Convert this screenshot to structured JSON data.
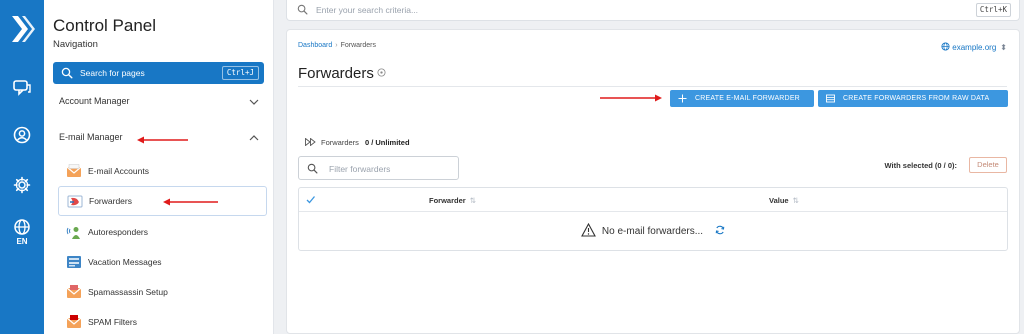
{
  "rail": {
    "language": "EN",
    "icons": [
      "logo-icon",
      "chat-icon",
      "account-icon",
      "settings-icon",
      "globe-icon"
    ]
  },
  "sidebar": {
    "title": "Control Panel",
    "subtitle": "Navigation",
    "search_label": "Search for pages",
    "search_shortcut": "Ctrl+J",
    "sections": [
      {
        "label": "Account Manager",
        "expanded": false
      },
      {
        "label": "E-mail Manager",
        "expanded": true
      }
    ],
    "items": [
      {
        "label": "E-mail Accounts",
        "icon": "email-accounts-icon"
      },
      {
        "label": "Forwarders",
        "icon": "forwarders-icon",
        "active": true
      },
      {
        "label": "Autoresponders",
        "icon": "autoresponders-icon"
      },
      {
        "label": "Vacation Messages",
        "icon": "vacation-messages-icon"
      },
      {
        "label": "Spamassassin Setup",
        "icon": "spamassassin-icon"
      },
      {
        "label": "SPAM Filters",
        "icon": "spam-filters-icon"
      }
    ]
  },
  "topbar": {
    "search_placeholder": "Enter your search criteria...",
    "shortcut": "Ctrl+K"
  },
  "main": {
    "breadcrumb": [
      "Dashboard",
      "Forwarders"
    ],
    "domain": "example.org",
    "title": "Forwarders",
    "buttons": {
      "create": "CREATE E-MAIL FORWARDER",
      "raw": "CREATE FORWARDERS FROM RAW DATA"
    },
    "count_label": "Forwarders",
    "count_value": "0 / Unlimited",
    "filter_placeholder": "Filter forwarders",
    "with_selected": "With selected (0 / 0):",
    "delete_label": "Delete",
    "columns": [
      "Forwarder",
      "Value"
    ],
    "empty_message": "No e-mail forwarders..."
  },
  "colors": {
    "brand": "#1877c5",
    "button": "#3c97e0",
    "annotation_arrow": "#e01b1b"
  }
}
